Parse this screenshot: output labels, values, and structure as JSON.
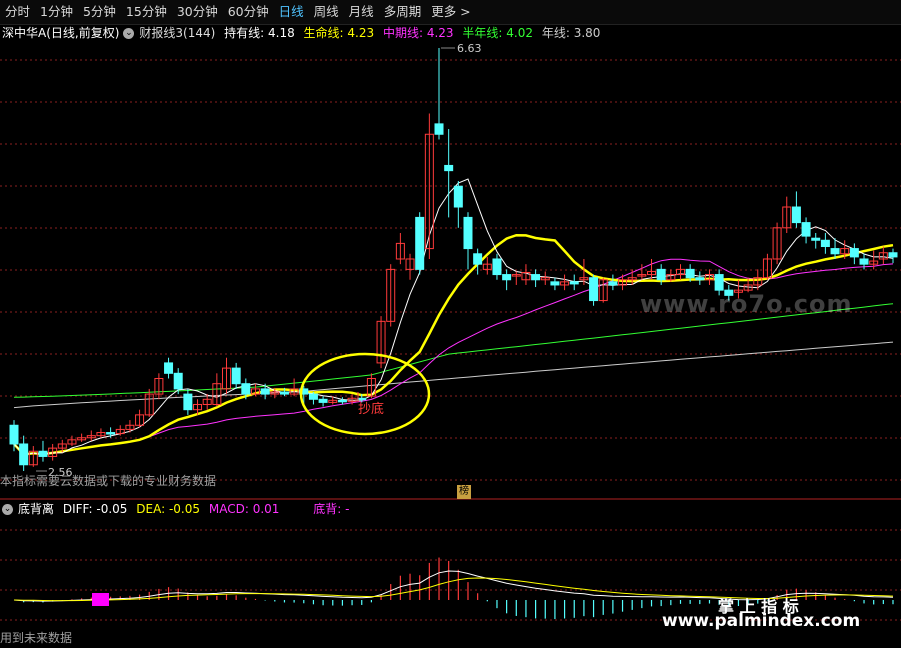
{
  "periods": [
    "分时",
    "1分钟",
    "5分钟",
    "15分钟",
    "30分钟",
    "60分钟",
    "日线",
    "周线",
    "月线",
    "多周期",
    "更多 >"
  ],
  "active_period": "日线",
  "main": {
    "title": "深中华A(日线,前复权)",
    "indicator_name": "财报线3(144)",
    "items": [
      {
        "label": "持有线:",
        "value": "4.18",
        "color": "#ffffff"
      },
      {
        "label": "生命线:",
        "value": "4.23",
        "color": "#ffff00"
      },
      {
        "label": "中期线:",
        "value": "4.23",
        "color": "#ff33ff"
      },
      {
        "label": "半年线:",
        "value": "4.02",
        "color": "#33ff33"
      },
      {
        "label": "年线:",
        "value": "3.80",
        "color": "#cccccc"
      }
    ],
    "high_label": "6.63",
    "low_label": "2.56",
    "bottom_signal": "抄底",
    "note": "本指标需要云数据或下载的专业财务数据",
    "badge": "榜"
  },
  "sub": {
    "name": "底背离",
    "items": [
      {
        "label": "DIFF:",
        "value": "-0.05",
        "color": "#ffffff"
      },
      {
        "label": "DEA:",
        "value": "-0.05",
        "color": "#ffff00"
      },
      {
        "label": "MACD:",
        "value": "0.01",
        "color": "#ff33ff"
      },
      {
        "label": "底背:",
        "value": "-",
        "color": "#ff33ff"
      }
    ],
    "note": "用到未来数据"
  },
  "watermarks": {
    "main_url": "www.ro7o.com",
    "brand": "掌 上 指 标",
    "brand_url": "www.palmindex.com"
  },
  "colors": {
    "up": "#ff3b3b",
    "down": "#54ffff",
    "bg": "#000000",
    "grid": "#8a1f1f"
  }
}
